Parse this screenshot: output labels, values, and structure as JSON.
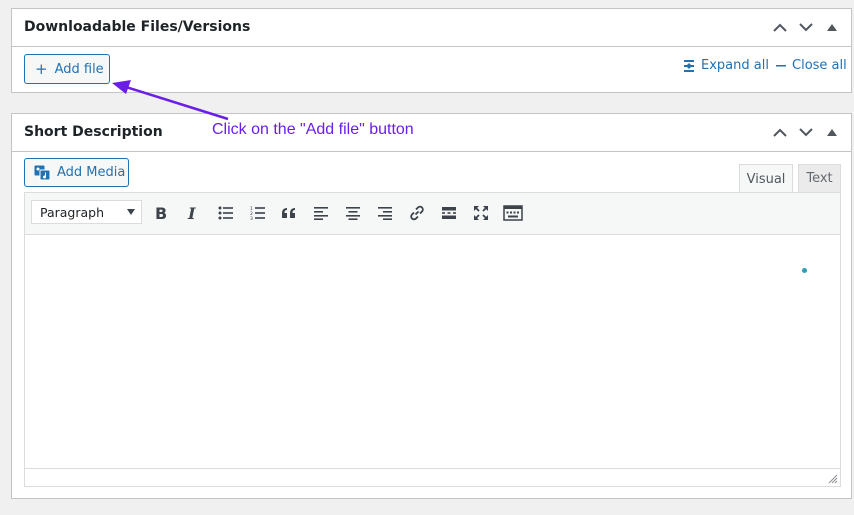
{
  "downloadable": {
    "title": "Downloadable Files/Versions",
    "add_file_label": "Add file",
    "expand_all_label": "Expand all",
    "close_all_label": "Close all"
  },
  "short_description": {
    "title": "Short Description",
    "add_media_label": "Add Media",
    "tabs": [
      {
        "label": "Visual",
        "active": true
      },
      {
        "label": "Text",
        "active": false
      }
    ],
    "format_select_value": "Paragraph",
    "toolbar_buttons": [
      "bold-icon",
      "italic-icon",
      "bullet-list-icon",
      "numbered-list-icon",
      "blockquote-icon",
      "align-left-icon",
      "align-center-icon",
      "align-right-icon",
      "link-icon",
      "read-more-icon",
      "fullscreen-icon",
      "toolbar-toggle-icon"
    ]
  },
  "annotation": {
    "text": "Click on the \"Add file\" button",
    "color": "#6a1ee6"
  },
  "colors": {
    "accent": "#2271b1",
    "background": "#f0f0f1",
    "border": "#c3c4c7"
  }
}
